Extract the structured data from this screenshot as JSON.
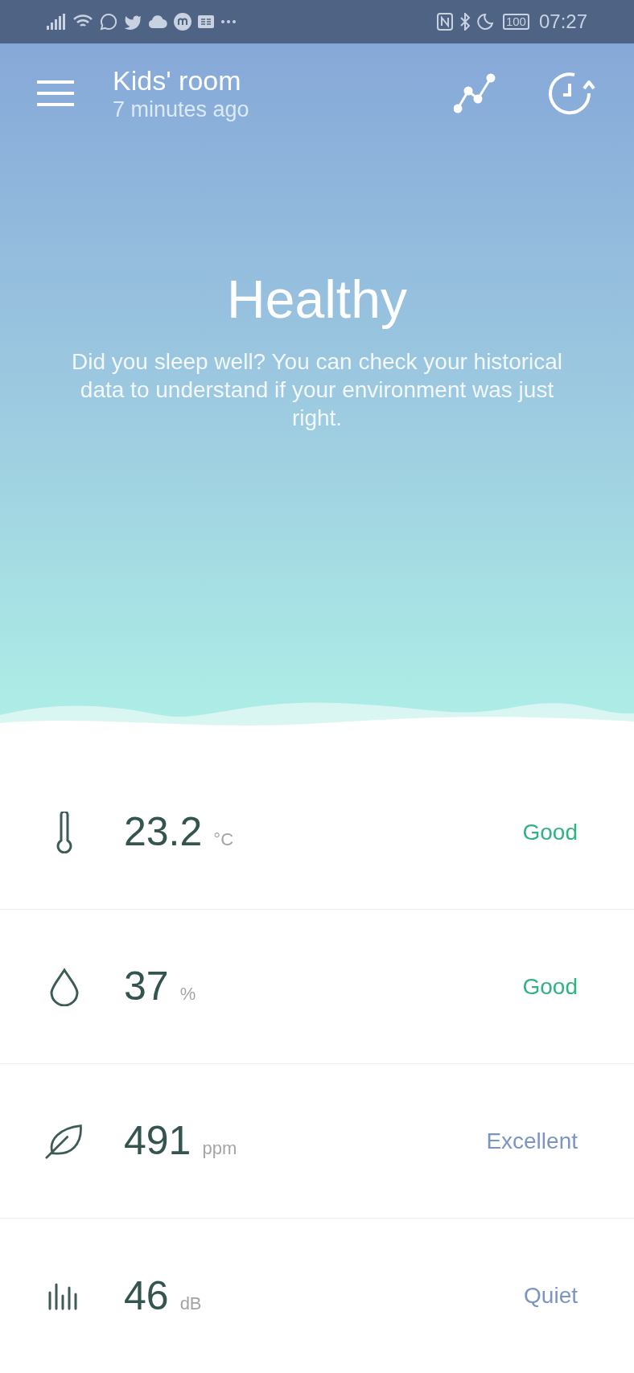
{
  "status_bar": {
    "battery": "100",
    "time": "07:27"
  },
  "header": {
    "title": "Kids' room",
    "subtitle": "7 minutes ago"
  },
  "summary": {
    "title": "Healthy",
    "message": "Did you sleep well? You can check your historical data to understand if your environment was just right."
  },
  "readings": [
    {
      "kind": "temperature",
      "value": "23.2",
      "unit": "°C",
      "status": "Good",
      "color": "#2fb383"
    },
    {
      "kind": "humidity",
      "value": "37",
      "unit": "%",
      "status": "Good",
      "color": "#2fb383"
    },
    {
      "kind": "co2",
      "value": "491",
      "unit": "ppm",
      "status": "Excellent",
      "color": "#7c95c0"
    },
    {
      "kind": "noise",
      "value": "46",
      "unit": "dB",
      "status": "Quiet",
      "color": "#7c95c0"
    }
  ]
}
